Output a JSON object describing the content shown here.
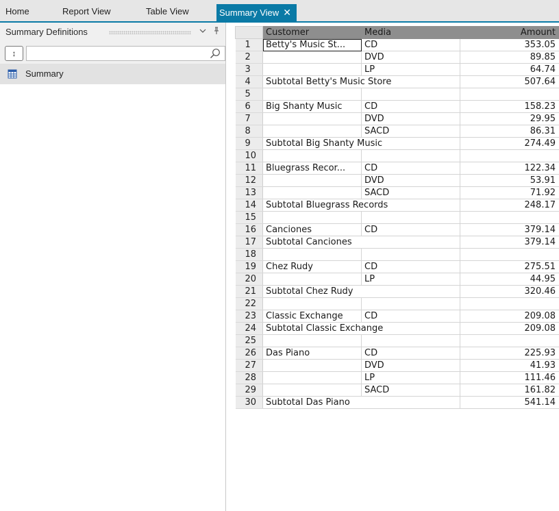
{
  "tabs": [
    {
      "label": "Home"
    },
    {
      "label": "Report View"
    },
    {
      "label": "Table View"
    },
    {
      "label": "Summary View"
    }
  ],
  "panel": {
    "title": "Summary Definitions",
    "sort_glyph": "↕",
    "search_value": "",
    "tree": [
      {
        "label": "Summary",
        "icon": "summary-table-icon"
      }
    ]
  },
  "grid": {
    "columns": [
      "Customer",
      "Media",
      "Amount"
    ],
    "rows": [
      {
        "n": "1",
        "customer": "Betty's Music St...",
        "media": "CD",
        "amount": "353.05"
      },
      {
        "n": "2",
        "customer": "",
        "media": "DVD",
        "amount": "89.85"
      },
      {
        "n": "3",
        "customer": "",
        "media": "LP",
        "amount": "64.74"
      },
      {
        "n": "4",
        "subtotal": "Subtotal Betty's Music Store",
        "amount": "507.64"
      },
      {
        "n": "5",
        "blank": true
      },
      {
        "n": "6",
        "customer": "Big Shanty Music",
        "media": "CD",
        "amount": "158.23"
      },
      {
        "n": "7",
        "customer": "",
        "media": "DVD",
        "amount": "29.95"
      },
      {
        "n": "8",
        "customer": "",
        "media": "SACD",
        "amount": "86.31"
      },
      {
        "n": "9",
        "subtotal": "Subtotal Big Shanty Music",
        "amount": "274.49"
      },
      {
        "n": "10",
        "blank": true
      },
      {
        "n": "11",
        "customer": "Bluegrass Recor...",
        "media": "CD",
        "amount": "122.34"
      },
      {
        "n": "12",
        "customer": "",
        "media": "DVD",
        "amount": "53.91"
      },
      {
        "n": "13",
        "customer": "",
        "media": "SACD",
        "amount": "71.92"
      },
      {
        "n": "14",
        "subtotal": "Subtotal Bluegrass Records",
        "amount": "248.17"
      },
      {
        "n": "15",
        "blank": true
      },
      {
        "n": "16",
        "customer": "Canciones",
        "media": "CD",
        "amount": "379.14"
      },
      {
        "n": "17",
        "subtotal": "Subtotal Canciones",
        "amount": "379.14"
      },
      {
        "n": "18",
        "blank": true
      },
      {
        "n": "19",
        "customer": "Chez Rudy",
        "media": "CD",
        "amount": "275.51"
      },
      {
        "n": "20",
        "customer": "",
        "media": "LP",
        "amount": "44.95"
      },
      {
        "n": "21",
        "subtotal": "Subtotal Chez Rudy",
        "amount": "320.46"
      },
      {
        "n": "22",
        "blank": true
      },
      {
        "n": "23",
        "customer": "Classic Exchange",
        "media": "CD",
        "amount": "209.08"
      },
      {
        "n": "24",
        "subtotal": "Subtotal Classic Exchange",
        "amount": "209.08"
      },
      {
        "n": "25",
        "blank": true
      },
      {
        "n": "26",
        "customer": "Das Piano",
        "media": "CD",
        "amount": "225.93"
      },
      {
        "n": "27",
        "customer": "",
        "media": "DVD",
        "amount": "41.93"
      },
      {
        "n": "28",
        "customer": "",
        "media": "LP",
        "amount": "111.46"
      },
      {
        "n": "29",
        "customer": "",
        "media": "SACD",
        "amount": "161.82"
      },
      {
        "n": "30",
        "subtotal": "Subtotal Das Piano",
        "amount": "541.14"
      }
    ]
  },
  "colors": {
    "accent": "#0a7aa6",
    "header_bg": "#8e8e8e",
    "rownum_bg": "#ececec"
  }
}
